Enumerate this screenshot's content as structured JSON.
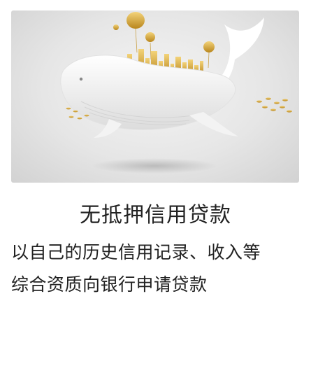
{
  "card": {
    "image_label": "whale-city-illustration",
    "title": "无抵押信用贷款",
    "description_lines": [
      "以自己的历史信用记录、收入等",
      "综合资质向银行申请贷款"
    ]
  },
  "colors": {
    "background": "#ffffff",
    "image_background": "#e6e6e6",
    "whale": "#f7f7f7",
    "gold_accent": "#d4a52c",
    "text": "#222222"
  }
}
